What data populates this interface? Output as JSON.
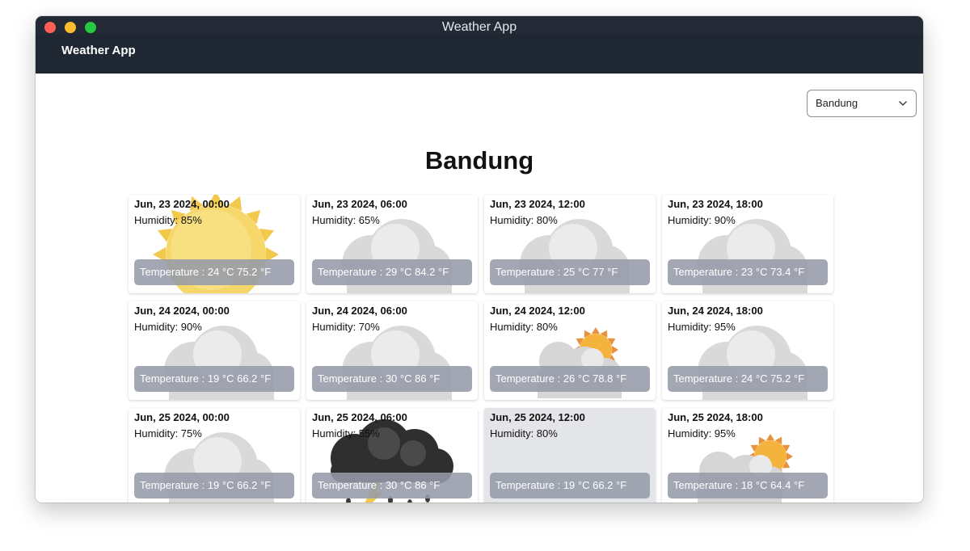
{
  "window": {
    "title": "Weather App"
  },
  "appbar": {
    "brand": "Weather App"
  },
  "location": {
    "selected": "Bandung",
    "heading": "Bandung"
  },
  "forecast": [
    {
      "datetime": "Jun, 23 2024, 00:00",
      "humidity": "Humidity: 85%",
      "temperature": "Temperature : 24 °C 75.2 °F",
      "icon": "sun-icon"
    },
    {
      "datetime": "Jun, 23 2024, 06:00",
      "humidity": "Humidity: 65%",
      "temperature": "Temperature : 29 °C 84.2 °F",
      "icon": "cloud-icon"
    },
    {
      "datetime": "Jun, 23 2024, 12:00",
      "humidity": "Humidity: 80%",
      "temperature": "Temperature : 25 °C 77 °F",
      "icon": "cloud-icon"
    },
    {
      "datetime": "Jun, 23 2024, 18:00",
      "humidity": "Humidity: 90%",
      "temperature": "Temperature : 23 °C 73.4 °F",
      "icon": "cloud-icon"
    },
    {
      "datetime": "Jun, 24 2024, 00:00",
      "humidity": "Humidity: 90%",
      "temperature": "Temperature : 19 °C 66.2 °F",
      "icon": "cloud-icon"
    },
    {
      "datetime": "Jun, 24 2024, 06:00",
      "humidity": "Humidity: 70%",
      "temperature": "Temperature : 30 °C 86 °F",
      "icon": "cloud-icon"
    },
    {
      "datetime": "Jun, 24 2024, 12:00",
      "humidity": "Humidity: 80%",
      "temperature": "Temperature : 26 °C 78.8 °F",
      "icon": "partly-cloudy-icon"
    },
    {
      "datetime": "Jun, 24 2024, 18:00",
      "humidity": "Humidity: 95%",
      "temperature": "Temperature : 24 °C 75.2 °F",
      "icon": "cloud-icon"
    },
    {
      "datetime": "Jun, 25 2024, 00:00",
      "humidity": "Humidity: 75%",
      "temperature": "Temperature : 19 °C 66.2 °F",
      "icon": "cloud-icon"
    },
    {
      "datetime": "Jun, 25 2024, 06:00",
      "humidity": "Humidity: 55%",
      "temperature": "Temperature : 30 °C 86 °F",
      "icon": "thunderstorm-icon"
    },
    {
      "datetime": "Jun, 25 2024, 12:00",
      "humidity": "Humidity: 80%",
      "temperature": "Temperature : 19 °C 66.2 °F",
      "icon": "none"
    },
    {
      "datetime": "Jun, 25 2024, 18:00",
      "humidity": "Humidity: 95%",
      "temperature": "Temperature : 18 °C 64.4 °F",
      "icon": "partly-cloudy-icon"
    }
  ]
}
